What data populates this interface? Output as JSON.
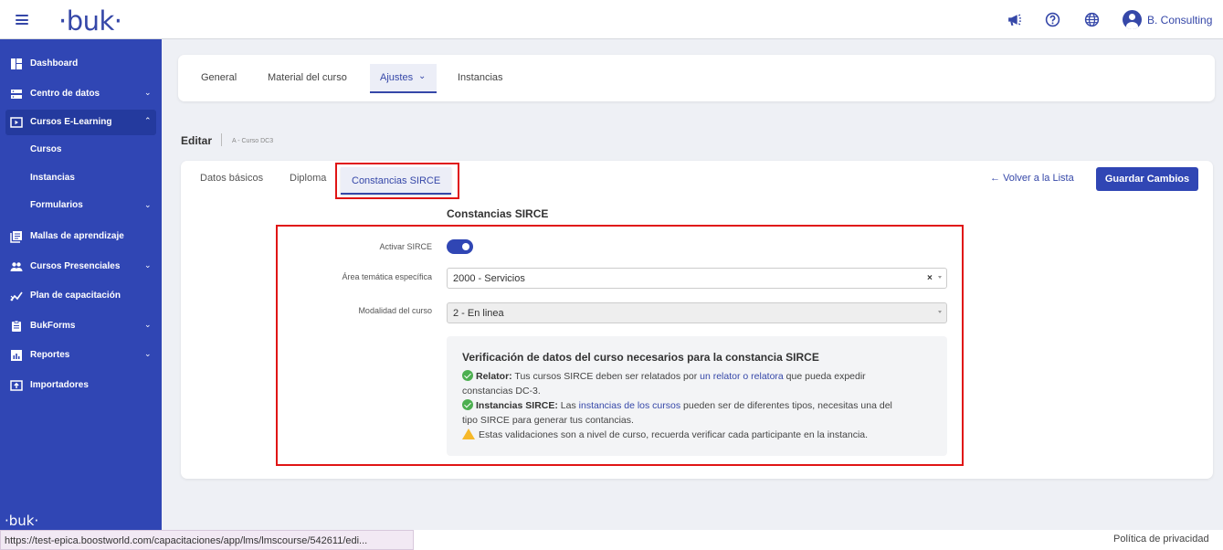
{
  "header": {
    "logo": "·buk·",
    "user_name": "B. Consulting"
  },
  "sidebar": {
    "items": [
      {
        "label": "Dashboard"
      },
      {
        "label": "Centro de datos"
      },
      {
        "label": "Cursos E-Learning"
      },
      {
        "label": "Mallas de aprendizaje"
      },
      {
        "label": "Cursos Presenciales"
      },
      {
        "label": "Plan de capacitación"
      },
      {
        "label": "BukForms"
      },
      {
        "label": "Reportes"
      },
      {
        "label": "Importadores"
      }
    ],
    "subitems": [
      {
        "label": "Cursos"
      },
      {
        "label": "Instancias"
      },
      {
        "label": "Formularios"
      }
    ],
    "footer_logo": "·buk·"
  },
  "top_tabs": [
    {
      "label": "General"
    },
    {
      "label": "Material del curso"
    },
    {
      "label": "Ajustes"
    },
    {
      "label": "Instancias"
    }
  ],
  "edit": {
    "title": "Editar",
    "subtitle": "A - Curso DC3"
  },
  "section_tabs": [
    {
      "label": "Datos básicos"
    },
    {
      "label": "Diploma"
    },
    {
      "label": "Constancias SIRCE"
    }
  ],
  "actions": {
    "back": "Volver a la Lista",
    "save": "Guardar Cambios"
  },
  "form": {
    "section_title": "Constancias SIRCE",
    "activate_label": "Activar SIRCE",
    "activate_on": true,
    "area_label": "Área temática específica",
    "area_value": "2000 - Servicios",
    "modalidad_label": "Modalidad del curso",
    "modalidad_value": "2 - En linea"
  },
  "info": {
    "title": "Verificación de datos del curso necesarios para la constancia SIRCE",
    "relator_label": "Relator:",
    "relator_text1": " Tus cursos SIRCE deben ser relatados por ",
    "relator_link": "un relator o relatora",
    "relator_text2": " que pueda expedir",
    "relator_text3": "constancias DC-3.",
    "instancias_label": "Instancias SIRCE:",
    "instancias_text1": " Las ",
    "instancias_link": "instancias de los cursos",
    "instancias_text2": " pueden ser de diferentes tipos, necesitas una del",
    "instancias_text3": "tipo SIRCE para generar tus contancias.",
    "warning_text": "Estas validaciones son a nivel de curso, recuerda verificar cada participante en la instancia."
  },
  "status": {
    "url": "https://test-epica.boostworld.com/capacitaciones/app/lms/lmscourse/542611/edi...",
    "privacy": "Política de privacidad"
  },
  "colors": {
    "brand": "#3046b4",
    "highlight": "#e01515"
  }
}
